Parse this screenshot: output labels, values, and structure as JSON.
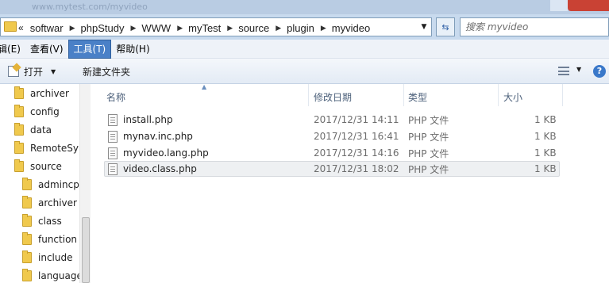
{
  "window": {
    "title_text": "www.mytest.com/myvideo"
  },
  "address": {
    "crumbs_lead": "«",
    "crumbs": [
      "softwar",
      "phpStudy",
      "WWW",
      "myTest",
      "source",
      "plugin",
      "myvideo"
    ],
    "search_placeholder": "搜索 myvideo"
  },
  "menu": {
    "items": [
      "辑(E)",
      "查看(V)",
      "工具(T)",
      "帮助(H)"
    ],
    "active_index": 2
  },
  "toolbar": {
    "open_label": "打开",
    "new_folder_label": "新建文件夹"
  },
  "nav": {
    "items": [
      {
        "label": "archiver",
        "level": 1
      },
      {
        "label": "config",
        "level": 1
      },
      {
        "label": "data",
        "level": 1
      },
      {
        "label": "RemoteSy",
        "level": 1
      },
      {
        "label": "source",
        "level": 1
      },
      {
        "label": "admincp",
        "level": 2
      },
      {
        "label": "archiver",
        "level": 2
      },
      {
        "label": "class",
        "level": 2
      },
      {
        "label": "function",
        "level": 2
      },
      {
        "label": "include",
        "level": 2
      },
      {
        "label": "language",
        "level": 2
      }
    ]
  },
  "file_list": {
    "columns": {
      "name": "名称",
      "date": "修改日期",
      "type": "类型",
      "size": "大小"
    },
    "rows": [
      {
        "name": "install.php",
        "date": "2017/12/31 14:11",
        "type": "PHP 文件",
        "size": "1 KB"
      },
      {
        "name": "mynav.inc.php",
        "date": "2017/12/31 16:41",
        "type": "PHP 文件",
        "size": "1 KB"
      },
      {
        "name": "myvideo.lang.php",
        "date": "2017/12/31 14:16",
        "type": "PHP 文件",
        "size": "1 KB"
      },
      {
        "name": "video.class.php",
        "date": "2017/12/31 18:02",
        "type": "PHP 文件",
        "size": "1 KB"
      }
    ],
    "selected_index": 3
  }
}
